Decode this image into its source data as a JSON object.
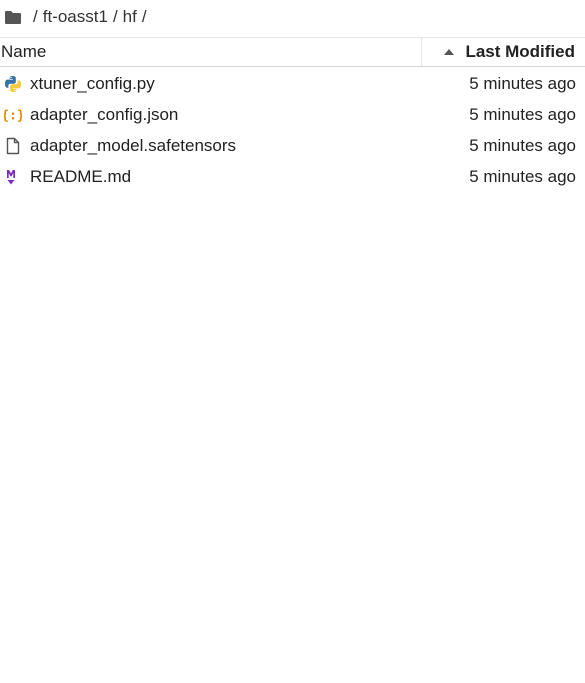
{
  "breadcrumb": {
    "home_icon": "folder-icon",
    "separator": "/",
    "parts": [
      "ft-oasst1",
      "hf"
    ]
  },
  "header": {
    "name_label": "Name",
    "modified_label": "Last Modified",
    "sort_icon": "sort-ascending-icon"
  },
  "files": [
    {
      "name": "xtuner_config.py",
      "modified": "5 minutes ago",
      "icon": "python-icon"
    },
    {
      "name": "adapter_config.json",
      "modified": "5 minutes ago",
      "icon": "json-icon"
    },
    {
      "name": "adapter_model.safetensors",
      "modified": "5 minutes ago",
      "icon": "file-icon"
    },
    {
      "name": "README.md",
      "modified": "5 minutes ago",
      "icon": "markdown-icon"
    }
  ],
  "colors": {
    "python_blue": "#3572A5",
    "python_yellow": "#F7C93E",
    "json_orange": "#E38A00",
    "markdown_purple": "#7B2FBE"
  }
}
